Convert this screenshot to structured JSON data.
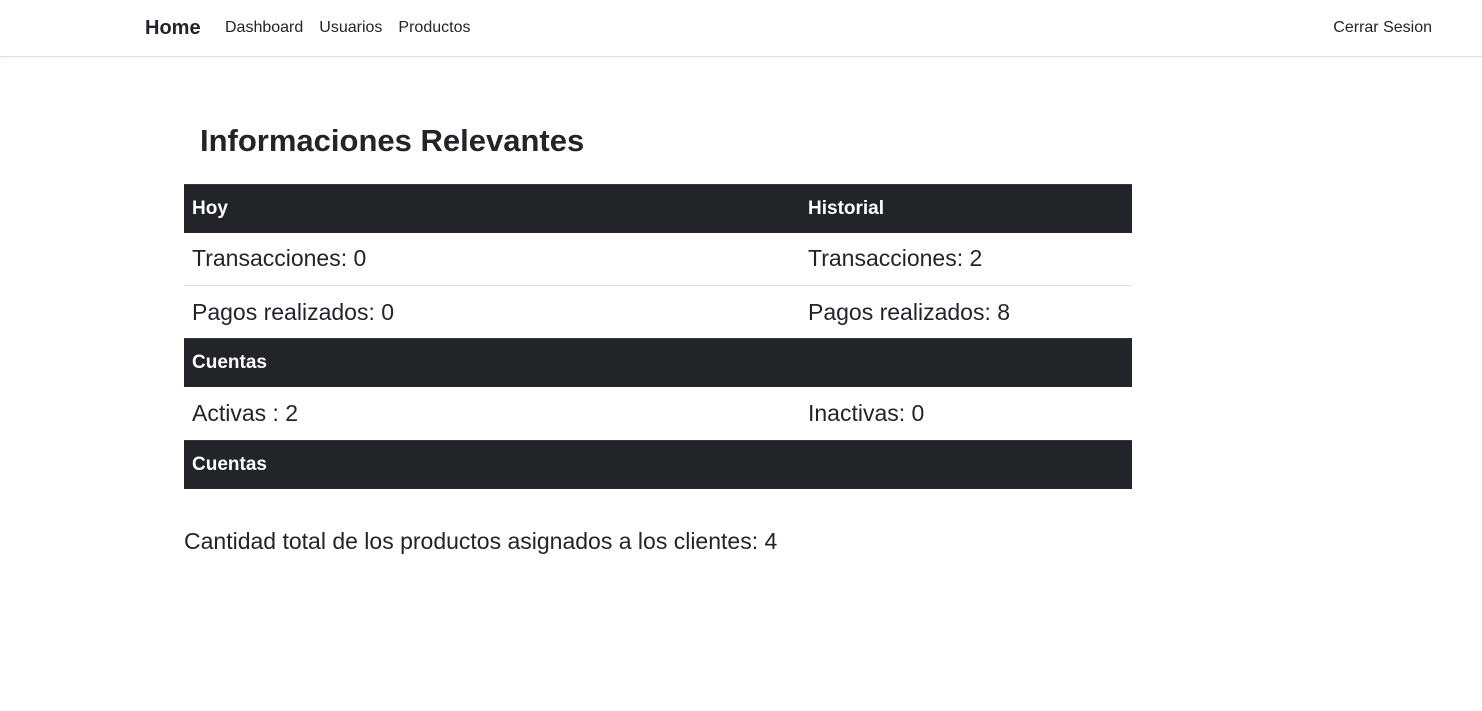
{
  "navbar": {
    "brand": "Home",
    "links": [
      "Dashboard",
      "Usuarios",
      "Productos"
    ],
    "logout": "Cerrar Sesion"
  },
  "main": {
    "title": "Informaciones Relevantes",
    "table": {
      "header1": {
        "left": "Hoy",
        "right": "Historial"
      },
      "row1": {
        "left": "Transacciones: 0",
        "right": "Transacciones: 2"
      },
      "row2": {
        "left": "Pagos realizados: 0",
        "right": "Pagos realizados: 8"
      },
      "header2": {
        "left": "Cuentas"
      },
      "row3": {
        "left": "Activas : 2",
        "right": "Inactivas: 0"
      },
      "header3": {
        "left": "Cuentas"
      }
    },
    "summary": "Cantidad total de los productos asignados a los clientes: 4"
  },
  "colors": {
    "header_bg": "#212529",
    "header_text": "#ffffff",
    "text": "#212529"
  }
}
